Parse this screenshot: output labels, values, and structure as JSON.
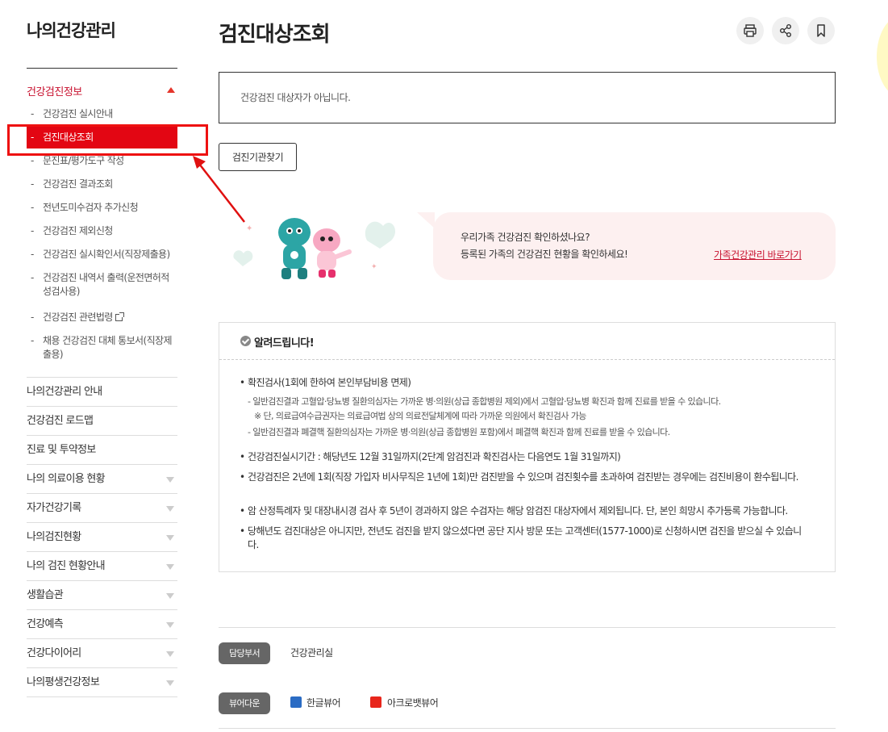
{
  "sidebar": {
    "title": "나의건강관리",
    "section_header": "건강검진정보",
    "sub_items": [
      {
        "label": "건강검진 실시안내"
      },
      {
        "label": "검진대상조회"
      },
      {
        "label": "문진표/평가도구 작성"
      },
      {
        "label": "건강검진 결과조회"
      },
      {
        "label": "전년도미수검자 추가신청"
      },
      {
        "label": "건강검진 제외신청"
      },
      {
        "label": "건강검진 실시확인서(직장제출용)"
      },
      {
        "label": "건강검진 내역서 출력(운전면허적성검사용)"
      },
      {
        "label": "건강검진 관련법령"
      },
      {
        "label": "채용 건강검진 대체 통보서(직장제출용)"
      }
    ],
    "menu_items": [
      {
        "label": "나의건강관리 안내"
      },
      {
        "label": "건강검진 로드맵"
      },
      {
        "label": "진료 및 투약정보"
      },
      {
        "label": "나의 의료이용 현황"
      },
      {
        "label": "자가건강기록"
      },
      {
        "label": "나의검진현황"
      },
      {
        "label": "나의 검진 현황안내"
      },
      {
        "label": "생활습관"
      },
      {
        "label": "건강예측"
      },
      {
        "label": "건강다이어리"
      },
      {
        "label": "나의평생건강정보"
      }
    ]
  },
  "main": {
    "page_title": "검진대상조회",
    "notice": "건강검진 대상자가 아닙니다.",
    "find_button": "검진기관찾기",
    "banner": {
      "line1": "우리가족 건강검진 확인하셨나요?",
      "line2": "등록된 가족의 건강검진 현황을 확인하세요!",
      "link": "가족건강관리 바로가기"
    },
    "info": {
      "title": "알려드립니다!",
      "b1": "확진검사(1회에 한하여 본인부담비용 면제)",
      "b1_s1": "- 일반검진결과 고혈압·당뇨병 질환의심자는 가까운 병·의원(상급 종합병원 제외)에서 고혈압·당뇨병 확진과 함께 진료를 받을 수 있습니다.",
      "b1_s2": "※ 단, 의료급여수급권자는 의료급여법 상의 의료전달체계에 따라 가까운 의원에서 확진검사 가능",
      "b1_s3": "- 일반검진결과 폐결핵 질환의심자는 가까운 병·의원(상급 종합병원 포함)에서 폐결핵 확진과 함께 진료를 받을 수 있습니다.",
      "b2": "건강검진실시기간 : 해당년도 12월 31일까지(2단계 암검진과 확진검사는 다음연도 1월 31일까지)",
      "b3": "건강검진은 2년에 1회(직장 가입자 비사무직은 1년에 1회)만 검진받을 수 있으며 검진횟수를 초과하여 검진받는 경우에는 검진비용이 환수됩니다.",
      "b4": "암 산정특례자 및 대장내시경 검사 후 5년이 경과하지 않은 수검자는 해당 암검진 대상자에서 제외됩니다. 단, 본인 희망시 추가등록 가능합니다.",
      "b5": "당해년도 검진대상은 아니지만, 전년도 검진을 받지 않으셨다면 공단 지사 방문 또는 고객센터(1577-1000)로 신청하시면 검진을 받으실 수 있습니다."
    },
    "footer": {
      "dept_label": "담당부서",
      "dept_value": "건강관리실",
      "viewer_label": "뷰어다운",
      "hwp_viewer": "한글뷰어",
      "pdf_viewer": "아크로뱃뷰어"
    }
  },
  "colors": {
    "accent": "#e30613",
    "link": "#c8102e",
    "banner_bg": "#fdf0f0"
  }
}
